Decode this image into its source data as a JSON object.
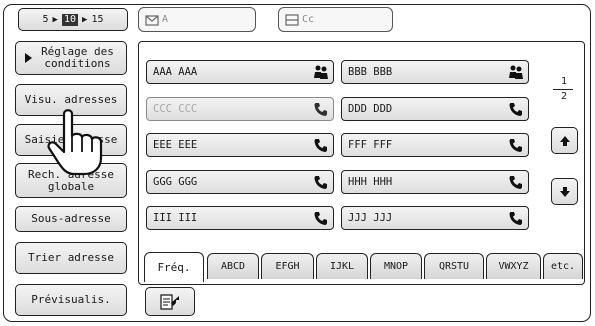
{
  "header": {
    "count_selector": {
      "opt1": "5",
      "opt2": "10",
      "opt3": "15"
    },
    "to_field_label": "A",
    "cc_field_label": "Cc"
  },
  "sidebar": {
    "conditions": "Réglage des conditions",
    "view_address": "Visu. adresses",
    "manual_entry": "Saisie adresse",
    "search_address": "Rech. adresse globale",
    "sub_address": "Sous-adresse",
    "sort_address": "Trier adresse",
    "preview": "Prévisualis."
  },
  "addresses": [
    {
      "name": "AAA AAA",
      "icon": "group-icon",
      "disabled": false
    },
    {
      "name": "BBB BBB",
      "icon": "group-icon",
      "disabled": false
    },
    {
      "name": "CCC CCC",
      "icon": "phone-icon",
      "disabled": true
    },
    {
      "name": "DDD DDD",
      "icon": "phone-icon",
      "disabled": false
    },
    {
      "name": "EEE EEE",
      "icon": "phone-icon",
      "disabled": false
    },
    {
      "name": "FFF FFF",
      "icon": "phone-icon",
      "disabled": false
    },
    {
      "name": "GGG GGG",
      "icon": "phone-icon",
      "disabled": false
    },
    {
      "name": "HHH HHH",
      "icon": "phone-icon",
      "disabled": false
    },
    {
      "name": "III III",
      "icon": "phone-icon",
      "disabled": false
    },
    {
      "name": "JJJ JJJ",
      "icon": "phone-icon",
      "disabled": false
    }
  ],
  "pagination": {
    "current": "1",
    "total": "2"
  },
  "tabs": [
    "Fréq.",
    "ABCD",
    "EFGH",
    "IJKL",
    "MNOP",
    "QRSTU",
    "VWXYZ",
    "etc."
  ]
}
